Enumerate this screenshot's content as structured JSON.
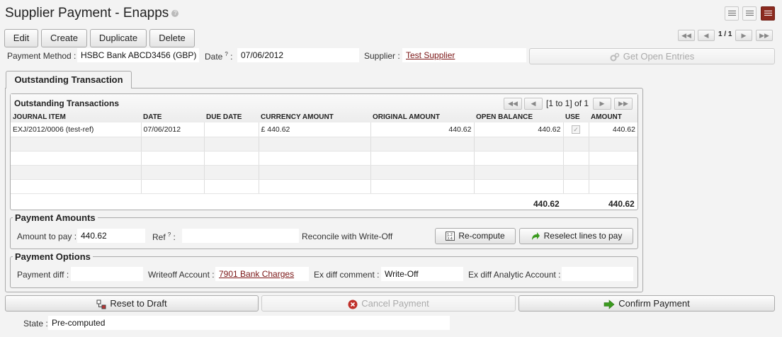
{
  "header": {
    "title": "Supplier Payment - Enapps",
    "help_glyph": "?",
    "pager_text": "1 / 1"
  },
  "toolbar": {
    "edit_label": "Edit",
    "create_label": "Create",
    "duplicate_label": "Duplicate",
    "delete_label": "Delete"
  },
  "form": {
    "payment_method_label": "Payment Method :",
    "payment_method_value": "HSBC Bank ABCD3456 (GBP)",
    "date_label": "Date",
    "date_help": "?",
    "date_colon": ":",
    "date_value": "07/06/2012",
    "supplier_label": "Supplier :",
    "supplier_value": "Test Supplier",
    "get_open_entries_label": "Get Open Entries"
  },
  "tabs": [
    {
      "label": "Outstanding Transaction"
    }
  ],
  "transactions": {
    "title": "Outstanding Transactions",
    "pager_text": "[1 to 1] of 1",
    "columns": [
      "JOURNAL ITEM",
      "DATE",
      "DUE DATE",
      "CURRENCY AMOUNT",
      "ORIGINAL AMOUNT",
      "OPEN BALANCE",
      "USE",
      "AMOUNT"
    ],
    "rows": [
      {
        "journal_item": "EXJ/2012/0006 (test-ref)",
        "date": "07/06/2012",
        "due_date": "",
        "currency_amount": "£ 440.62",
        "original_amount": "440.62",
        "open_balance": "440.62",
        "use": true,
        "amount": "440.62"
      }
    ],
    "total_open_balance": "440.62",
    "total_amount": "440.62"
  },
  "payment_amounts": {
    "legend": "Payment Amounts",
    "amount_label": "Amount to pay :",
    "amount_value": "440.62",
    "ref_label": "Ref",
    "ref_help": "?",
    "ref_colon": ":",
    "ref_value": "",
    "reconcile_label": "Reconcile with Write-Off",
    "recompute_label": "Re-compute",
    "reselect_label": "Reselect lines to pay"
  },
  "payment_options": {
    "legend": "Payment Options",
    "diff_label": "Payment diff :",
    "diff_value": "",
    "writeoff_label": "Writeoff Account :",
    "writeoff_value": "7901 Bank Charges",
    "comment_label": "Ex diff comment :",
    "comment_value": "Write-Off",
    "analytic_label": "Ex diff Analytic Account :",
    "analytic_value": ""
  },
  "actions": {
    "reset_label": "Reset to Draft",
    "cancel_label": "Cancel Payment",
    "confirm_label": "Confirm Payment"
  },
  "state": {
    "label": "State :",
    "value": "Pre-computed"
  },
  "colors": {
    "link": "#7a1515",
    "active_view": "#8b2a1f",
    "confirm_arrow": "#3a9a1e",
    "cancel_icon": "#c0302a"
  },
  "icons": [
    "help-icon",
    "list-view-icon",
    "detail-view-icon",
    "form-view-icon",
    "first-page-icon",
    "prev-page-icon",
    "next-page-icon",
    "last-page-icon",
    "gears-icon",
    "checkbox-icon",
    "recompute-icon",
    "green-arrow-icon",
    "workflow-icon",
    "cancel-icon"
  ]
}
